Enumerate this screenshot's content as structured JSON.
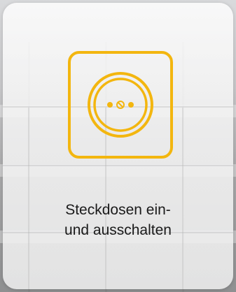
{
  "tile": {
    "label_line1": "Steckdosen ein-",
    "label_line2": "und ausschalten",
    "icon": "power-socket-icon"
  },
  "colors": {
    "accent": "#f3b60f",
    "card": "#f2f2f2",
    "text": "#1a1a1a"
  }
}
